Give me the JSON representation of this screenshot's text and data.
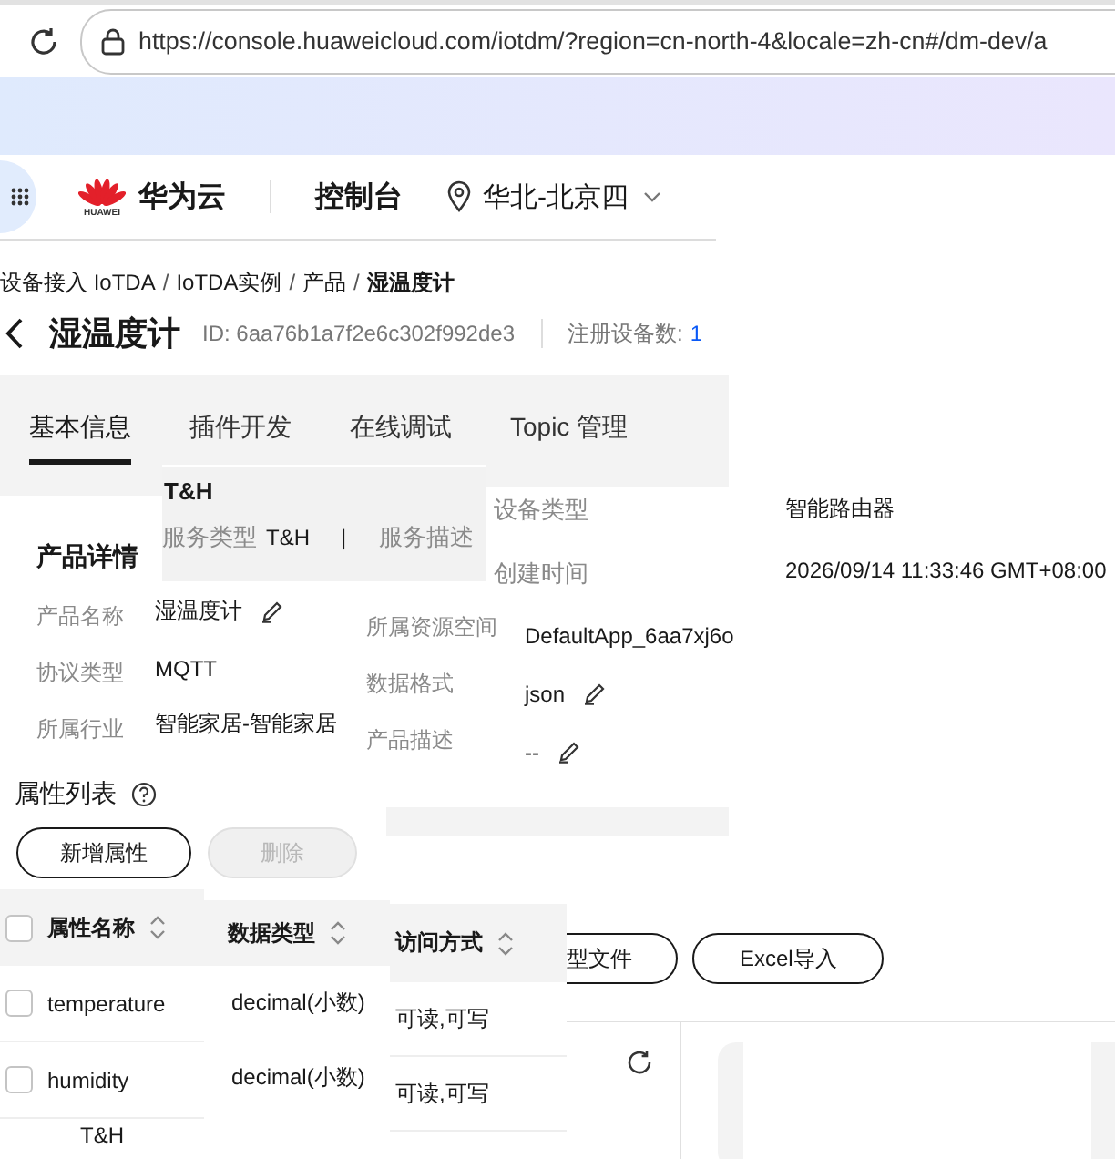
{
  "browser": {
    "url": "https://console.huaweicloud.com/iotdm/?region=cn-north-4&locale=zh-cn#/dm-dev/a"
  },
  "header": {
    "logo_text": "HUAWEI",
    "brand": "华为云",
    "console": "控制台",
    "region": "华北-北京四"
  },
  "breadcrumb": {
    "separator": "/",
    "items": [
      "设备接入 IoTDA",
      "IoTDA实例",
      "产品",
      "湿温度计"
    ]
  },
  "title": {
    "name": "湿温度计",
    "id": "ID: 6aa76b1a7f2e6c302f992de3",
    "devices_label": "注册设备数:",
    "devices_count": "1"
  },
  "tabs": [
    {
      "label": "基本信息",
      "selected": true
    },
    {
      "label": "插件开发",
      "selected": false
    },
    {
      "label": "在线调试",
      "selected": false
    },
    {
      "label": "Topic 管理",
      "selected": false
    }
  ],
  "service_panel": {
    "title": "T&H",
    "type_label": "服务类型",
    "type_value": "T&H",
    "divider": "|",
    "desc_label": "服务描述"
  },
  "device_info": [
    {
      "label": "设备类型",
      "value": "智能路由器"
    },
    {
      "label": "创建时间",
      "value": "2026/09/14 11:33:46 GMT+08:00"
    }
  ],
  "product_details": {
    "title": "产品详情",
    "left": [
      {
        "label": "产品名称",
        "value": "湿温度计",
        "editable": true
      },
      {
        "label": "协议类型",
        "value": "MQTT",
        "editable": false
      },
      {
        "label": "所属行业",
        "value": "智能家居-智能家居",
        "editable": false
      }
    ],
    "right": [
      {
        "label": "所属资源空间",
        "value": "DefaultApp_6aa7xj6o",
        "editable": false
      },
      {
        "label": "数据格式",
        "value": "json",
        "editable": true
      },
      {
        "label": "产品描述",
        "value": "--",
        "editable": true
      }
    ]
  },
  "properties": {
    "title": "属性列表",
    "buttons": [
      {
        "label": "新增属性",
        "disabled": false
      },
      {
        "label": "删除",
        "disabled": true
      }
    ],
    "columns": [
      {
        "label": "属性名称"
      },
      {
        "label": "数据类型"
      },
      {
        "label": "访问方式"
      }
    ],
    "header_checked": false,
    "rows": [
      {
        "name": "temperature",
        "type": "decimal(小数)",
        "access": "可读,可写",
        "checked": false
      },
      {
        "name": "humidity",
        "type": "decimal(小数)",
        "access": "可读,可写",
        "checked": false
      }
    ],
    "footer": "T&H"
  },
  "import_buttons": [
    "型文件",
    "Excel导入"
  ]
}
